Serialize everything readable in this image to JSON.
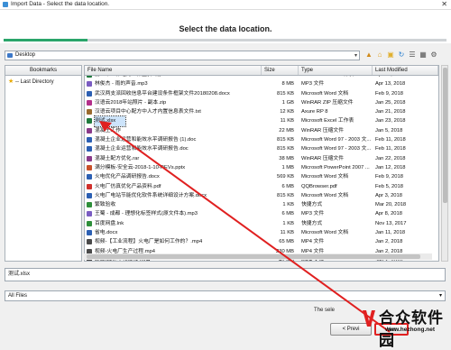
{
  "window": {
    "title": "Import Data - Select the data location.",
    "close_glyph": "✕"
  },
  "header": {
    "step_title": "Select the data location.",
    "progress_fraction": 0.19,
    "progress_color": "#2aa56a"
  },
  "location": {
    "value": "Desktop",
    "dropdown_glyph": "▾"
  },
  "toolbar": {
    "icons": [
      "up-folder-icon",
      "home-icon",
      "new-folder-icon",
      "refresh-icon",
      "list-view-icon",
      "details-view-icon",
      "options-icon"
    ]
  },
  "bookmarks": {
    "header": "Bookmarks",
    "items": [
      {
        "label": "-- Last Directory"
      }
    ]
  },
  "files": {
    "columns": {
      "name": "File Name",
      "size": "Size",
      "type": "Type",
      "modified": "Last Modified"
    },
    "rows": [
      {
        "name": "第二个工作站的工作量(下载).xlsx",
        "size": "",
        "type": "Microsoft Excel 工作表",
        "modified": "Apr 12, 2018",
        "icon": "excel-icon",
        "color": "#1f7a3d"
      },
      {
        "name": "林俊杰 - 雨的声音.mp3",
        "size": "8 MB",
        "type": "MP3 文件",
        "modified": "Apr 13, 2018",
        "icon": "mp3-icon",
        "color": "#7a5cc2"
      },
      {
        "name": "武汉两支派回收信息平台建设条件框架文件20180208.docx",
        "size": "815 KB",
        "type": "Microsoft Word 文档",
        "modified": "Feb 9, 2018",
        "icon": "word-icon",
        "color": "#2b5fb3"
      },
      {
        "name": "汉语云2018年站照片 - 副本.zip",
        "size": "1 GB",
        "type": "WinRAR ZIP 压缩文件",
        "modified": "Jan 25, 2018",
        "icon": "zip-icon",
        "color": "#b32e8a"
      },
      {
        "name": "汉语云项目中心配方中人才内置信息表文件.txt",
        "size": "12 KB",
        "type": "Axure RP 8",
        "modified": "Jan 21, 2018",
        "icon": "doc-icon",
        "color": "#9a6a2e"
      },
      {
        "name": "测试.xlsx",
        "size": "11 KB",
        "type": "Microsoft Excel 工作表",
        "modified": "Jan 23, 2018",
        "icon": "excel-icon",
        "color": "#1f7a3d"
      },
      {
        "name": "混凝土工作",
        "size": "22 MB",
        "type": "WinRAR 压缩文件",
        "modified": "Jan 5, 2018",
        "icon": "rar-icon",
        "color": "#8a3a8a"
      },
      {
        "name": "混凝土企业运营和能效水平调研报告 (1).doc",
        "size": "815 KB",
        "type": "Microsoft Word 97 - 2003 文...",
        "modified": "Feb 11, 2018",
        "icon": "word-icon",
        "color": "#2b5fb3"
      },
      {
        "name": "混凝土企业运营和能效水平调研报告.doc",
        "size": "815 KB",
        "type": "Microsoft Word 97 - 2003 文...",
        "modified": "Feb 11, 2018",
        "icon": "word-icon",
        "color": "#2b5fb3"
      },
      {
        "name": "混凝土配方优化.rar",
        "size": "38 MB",
        "type": "WinRAR 压缩文件",
        "modified": "Jan 22, 2018",
        "icon": "rar-icon",
        "color": "#8a3a8a"
      },
      {
        "name": "满分模板-安全云-2018-1-10-REVs.pptx",
        "size": "1 MB",
        "type": "Microsoft PowerPoint 2007 ...",
        "modified": "Jan 12, 2018",
        "icon": "ppt-icon",
        "color": "#c8502a"
      },
      {
        "name": "火电优化产品调研报告.docx",
        "size": "569 KB",
        "type": "Microsoft Word 文档",
        "modified": "Feb 9, 2018",
        "icon": "word-icon",
        "color": "#2b5fb3"
      },
      {
        "name": "火电厂仿真优化产品资料.pdf",
        "size": "6 MB",
        "type": "QQBrowser.pdf",
        "modified": "Feb 5, 2018",
        "icon": "pdf-icon",
        "color": "#d0302c"
      },
      {
        "name": "火电厂电站节能优化软件系统详细设计方案.docx",
        "size": "815 KB",
        "type": "Microsoft Word 文档",
        "modified": "Apr 3, 2018",
        "icon": "word-icon",
        "color": "#2b5fb3"
      },
      {
        "name": "繁致验收",
        "size": "1 KB",
        "type": "快捷方式",
        "modified": "Mar 20, 2018",
        "icon": "shortcut-icon",
        "color": "#2e8f3a"
      },
      {
        "name": "王蜀 - 成都 - 理想化标签样式(原文件本).mp3",
        "size": "6 MB",
        "type": "MP3 文件",
        "modified": "Apr 8, 2018",
        "icon": "mp3-icon",
        "color": "#7a5cc2"
      },
      {
        "name": "百度网盘.lnk",
        "size": "1 KB",
        "type": "快捷方式",
        "modified": "Nov 13, 2017",
        "icon": "shortcut-icon",
        "color": "#2e8f3a"
      },
      {
        "name": "省电.docx",
        "size": "11 KB",
        "type": "Microsoft Word 文档",
        "modified": "Jan 11, 2018",
        "icon": "word-icon",
        "color": "#2b5fb3"
      },
      {
        "name": "视频-【工业流程】火电厂是如何工作的？.mp4",
        "size": "65 MB",
        "type": "MP4 文件",
        "modified": "Jan 2, 2018",
        "icon": "mp4-icon",
        "color": "#4a4a4a"
      },
      {
        "name": "视频-火电厂生产过程.mp4",
        "size": "230 MB",
        "type": "MP4 文件",
        "modified": "Jan 2, 2018",
        "icon": "mp4-icon",
        "color": "#4a4a4a"
      },
      {
        "name": "视频-锅炉工作原理.mp4",
        "size": "42 MB",
        "type": "MP4 文件",
        "modified": "Jan 2, 2018",
        "icon": "mp4-icon",
        "color": "#4a4a4a"
      },
      {
        "name": "谈谈资产优化介绍(由国内外企业).doc",
        "size": "815 KB",
        "type": "Microsoft Word 文档",
        "modified": "Jan 18, 2018",
        "icon": "word-icon",
        "color": "#2b5fb3"
      },
      {
        "name": "运营系统设计说明.docx",
        "size": "815 KB",
        "type": "Microsoft Word 文档",
        "modified": "Jan 18, 2018",
        "icon": "word-icon",
        "color": "#2b5fb3"
      }
    ],
    "selected_index": 5
  },
  "filename_field": {
    "value": "测试.xlsx"
  },
  "file_type_filter": {
    "value": "All Files",
    "dropdown_glyph": "▾"
  },
  "footer": {
    "hint_text": "The sele"
  },
  "buttons": {
    "previous": "< Previ",
    "next": "Nex"
  },
  "annotation_color": "#e02020",
  "watermark": {
    "text": "合众软件园",
    "url": "www.hezhong.net"
  }
}
